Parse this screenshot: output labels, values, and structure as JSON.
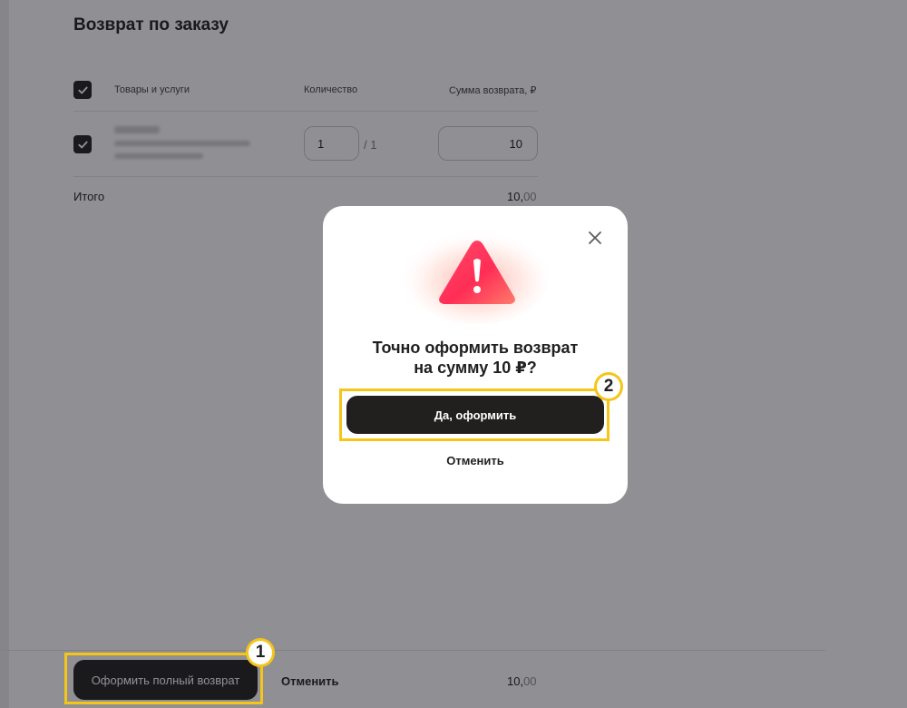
{
  "page": {
    "title": "Возврат по заказу",
    "table": {
      "columns": [
        "Товары и услуги",
        "Количество",
        "Сумма возврата, ₽"
      ],
      "rows": [
        {
          "quantity_value": "1",
          "quantity_total": "/ 1",
          "refund_value": "10"
        }
      ]
    },
    "total": {
      "label": "Итого",
      "value_main": "10,",
      "value_cents": "00"
    }
  },
  "footer": {
    "full_return_label": "Оформить полный возврат",
    "cancel_label": "Отменить",
    "total_main": "10,",
    "total_cents": "00"
  },
  "dialog": {
    "title": "Точно оформить возврат\nна сумму 10 ₽?",
    "confirm_label": "Да, оформить",
    "cancel_label": "Отменить"
  },
  "annotations": {
    "badge_1": "1",
    "badge_2": "2"
  },
  "colors": {
    "primary_dark": "#21201f",
    "highlight": "#f5c518",
    "warning_red": "#ff3b53"
  },
  "icons": [
    "check-icon",
    "close-icon",
    "warning-icon"
  ]
}
